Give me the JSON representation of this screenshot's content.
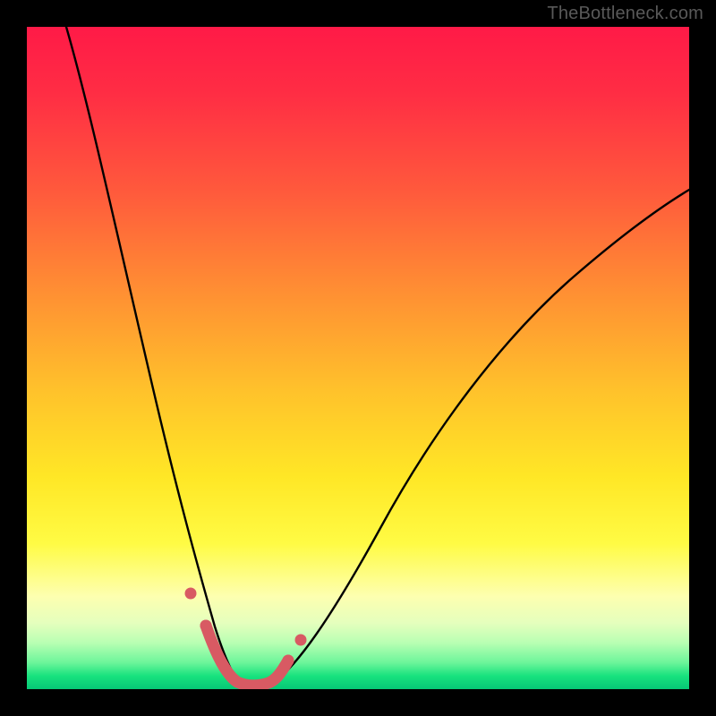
{
  "watermark": "TheBottleneck.com",
  "colors": {
    "background": "#000000",
    "curve": "#000000",
    "marker_stroke": "#d85a63",
    "marker_fill": "#d85a63",
    "gradient_top": "#ff1a47",
    "gradient_bottom": "#06c776"
  },
  "chart_data": {
    "type": "line",
    "title": "",
    "xlabel": "",
    "ylabel": "",
    "xlim": [
      0,
      100
    ],
    "ylim": [
      0,
      100
    ],
    "note": "Bottleneck curve: y-axis is bottleneck % (0 at bottom, ~100 at top). Minimum ~0% near x≈31–36. Left curve rises steeply toward ~100% as x→6; right curve rises toward ~70% as x→100.",
    "series": [
      {
        "name": "left-branch",
        "x": [
          6,
          10,
          14,
          18,
          22,
          25,
          27,
          29,
          31
        ],
        "y": [
          100,
          82,
          64,
          47,
          31,
          19,
          11,
          5,
          1
        ]
      },
      {
        "name": "right-branch",
        "x": [
          36,
          40,
          45,
          50,
          56,
          63,
          72,
          82,
          92,
          100
        ],
        "y": [
          1,
          6,
          14,
          22,
          31,
          40,
          49,
          57,
          64,
          70
        ]
      }
    ],
    "highlight_segment": {
      "description": "Thick salmon segment at valley bottom with dot markers at its ends and two outer dots",
      "points_x": [
        26.5,
        28.5,
        30.5,
        32.5,
        34.0,
        35.5,
        37.0,
        38.8
      ],
      "points_y": [
        10.5,
        5.0,
        1.5,
        0.6,
        0.6,
        0.8,
        1.8,
        4.8
      ],
      "outer_dots_x": [
        24.2,
        40.8
      ],
      "outer_dots_y": [
        16.0,
        9.0
      ]
    }
  }
}
